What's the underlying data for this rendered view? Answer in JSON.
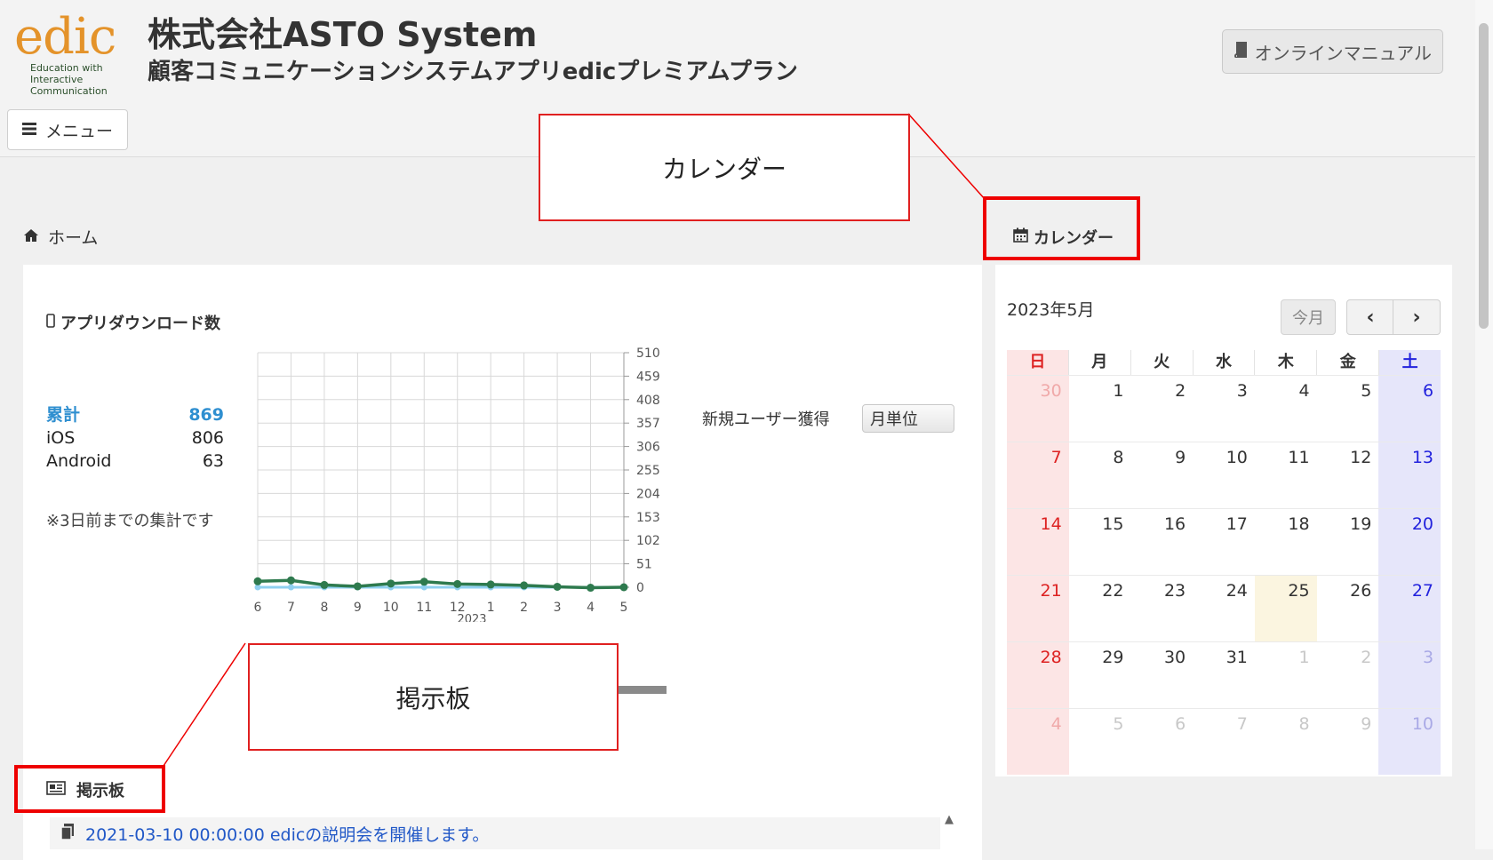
{
  "header": {
    "logo_text": "edic",
    "logo_tagline": [
      "Education with",
      "Interactive",
      "Communication"
    ],
    "company": "株式会社ASTO System",
    "subtitle": "顧客コミュニケーションシステムアプリedicプレミアムプラン",
    "manual_button": "オンラインマニュアル",
    "menu_button": "メニュー"
  },
  "breadcrumb": {
    "home": "ホーム"
  },
  "downloads": {
    "title": "アプリダウンロード数",
    "total_label": "累計",
    "total_value": "869",
    "ios_label": "iOS",
    "ios_value": "806",
    "android_label": "Android",
    "android_value": "63",
    "note": "※3日前までの集計です",
    "new_user_label": "新規ユーザー獲得",
    "unit_select": "月単位"
  },
  "chart_data": {
    "type": "line",
    "x": [
      "6",
      "7",
      "8",
      "9",
      "10",
      "11",
      "12",
      "1",
      "2",
      "3",
      "4",
      "5"
    ],
    "xlabel": "2023",
    "ylabel": "",
    "yticks": [
      "510",
      "459",
      "408",
      "357",
      "306",
      "255",
      "204",
      "153",
      "102",
      "51",
      "0"
    ],
    "ylim": [
      0,
      510
    ],
    "grid": true,
    "series": [
      {
        "values": [
          13,
          15,
          5,
          2,
          8,
          12,
          7,
          6,
          4,
          1,
          -1,
          0
        ],
        "color": "#2e7a4e"
      },
      {
        "values": [
          0,
          0,
          0,
          0,
          0,
          0,
          0,
          0,
          0,
          0,
          0,
          0
        ],
        "color": "#8fd0f0"
      }
    ]
  },
  "calendar": {
    "title": "カレンダー",
    "month": "2023年5月",
    "today_button": "今月",
    "prev_icon": "‹",
    "next_icon": "›",
    "weekdays": [
      "日",
      "月",
      "火",
      "水",
      "木",
      "金",
      "土"
    ],
    "weeks": [
      [
        "30",
        "1",
        "2",
        "3",
        "4",
        "5",
        "6"
      ],
      [
        "7",
        "8",
        "9",
        "10",
        "11",
        "12",
        "13"
      ],
      [
        "14",
        "15",
        "16",
        "17",
        "18",
        "19",
        "20"
      ],
      [
        "21",
        "22",
        "23",
        "24",
        "25",
        "26",
        "27"
      ],
      [
        "28",
        "29",
        "30",
        "31",
        "1",
        "2",
        "3"
      ],
      [
        "4",
        "5",
        "6",
        "7",
        "8",
        "9",
        "10"
      ]
    ]
  },
  "board": {
    "title": "掲示板",
    "items": [
      {
        "text": "2021-03-10 00:00:00 edicの説明会を開催します。"
      }
    ]
  },
  "annotations": {
    "calendar_callout": "カレンダー",
    "board_callout": "掲示板"
  },
  "colors": {
    "accent": "#2f8fd0",
    "highlight": "#e00000",
    "logo": "#e4932a"
  }
}
